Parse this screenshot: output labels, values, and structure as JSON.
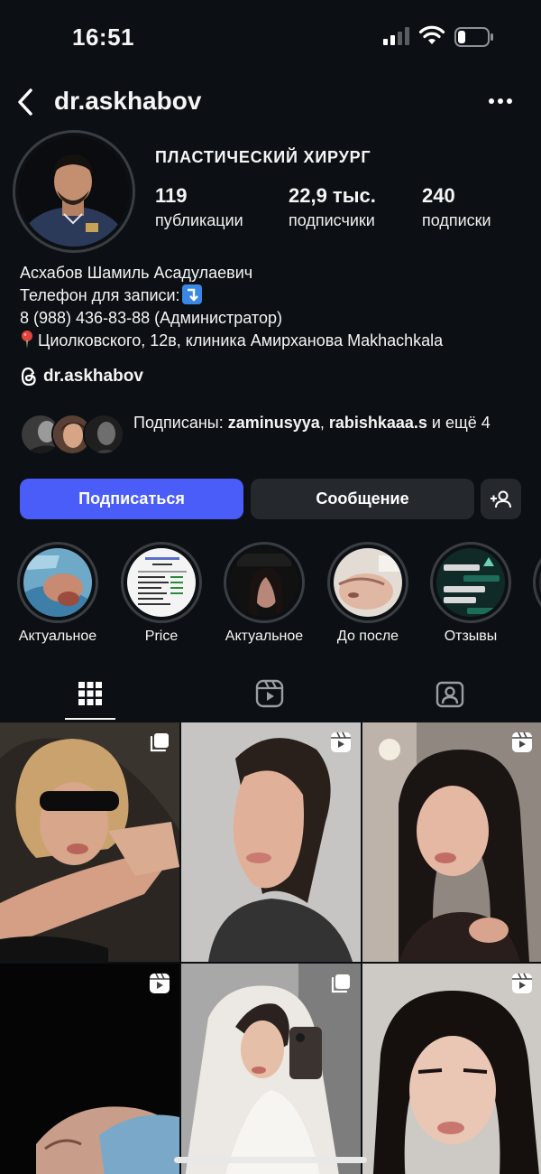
{
  "status_bar": {
    "time": "16:51"
  },
  "header": {
    "username": "dr.askhabov"
  },
  "profile": {
    "category": "ПЛАСТИЧЕСКИЙ ХИРУРГ",
    "stats": [
      {
        "value": "119",
        "label": "публикации"
      },
      {
        "value": "22,9 тыс.",
        "label": "подписчики"
      },
      {
        "value": "240",
        "label": "подписки"
      }
    ],
    "bio": {
      "name": "Асхабов Шамиль Асадулаевич",
      "phone_label": "Телефон для записи:",
      "phone": "8 (988) 436-83-88 (Администратор)",
      "address": "Циолковского, 12в, клиника Амирханова Makhachkala"
    },
    "threads_handle": "dr.askhabov",
    "followed_by": {
      "prefix": "Подписаны: ",
      "user1": "zaminusyya",
      "sep": ", ",
      "user2": "rabishkaaa.s",
      "suffix": " и ещё 4"
    }
  },
  "buttons": {
    "follow": "Подписаться",
    "message": "Сообщение"
  },
  "highlights": [
    {
      "label": "Актуальное"
    },
    {
      "label": "Price"
    },
    {
      "label": "Актуальное"
    },
    {
      "label": "До после"
    },
    {
      "label": "Отзывы"
    }
  ],
  "tabs": [
    "grid-icon",
    "reels-icon",
    "tagged-icon"
  ],
  "colors": {
    "background": "#0c1014",
    "follow_button": "#4a5df9",
    "secondary_button": "#25292e"
  }
}
